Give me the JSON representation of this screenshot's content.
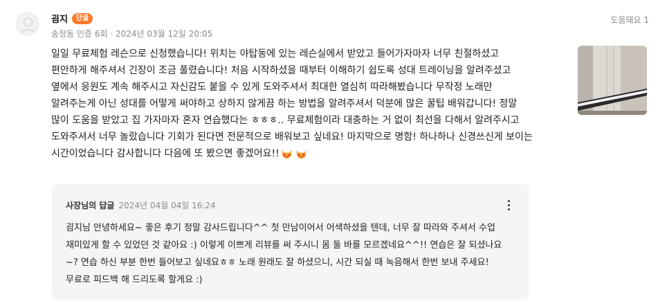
{
  "review": {
    "author": "굄지",
    "badge": "단골",
    "meta": "송정동 인증 6회 · 2024년 03월 12일 20:05",
    "helpful_label": "도움돼요 1",
    "body": "일일 무료체험 레슨으로 신청했습니다! 위치는 야탑동에 있는 레슨실에서 받았고 들어가자마자 너무 친절하셨고 편안하게 해주셔서 긴장이 조금 풀렸습니다! 처음 시작하셨을 때부터 이해하기 쉽도록 성대 트레이닝을 알려주셨고 옆에서 응원도 계속 해주시고 자신감도 붙을 수 있게 도와주셔서 최대한 열심히 따라해봤습니다 무작정 노래만 알려주는게 아닌 성대를 어떻게 써야하고 상하지 않게끔 하는 방법을 알려주셔서 덕분에 많은 꿀팁 배워갑니다! 정말 많이 도움을 받았고 집 가자마자 혼자 연습했다는 ㅎㅎㅎ.. 무료체험이라 대충하는 거 없이 최선을 다해서 알려주시고 도와주셔서 너무 놀랐습니다 기회가 된다면 전문적으로 배워보고 싶네요! 마지막으로 명함! 하나하나 신경쓰신게 보이는 시간이었습니다 감사합니다 다음에 또 봤으면 좋겠어요!!",
    "emojis": [
      "star-struck-cat-emoji",
      "star-struck-cat-emoji"
    ]
  },
  "reply": {
    "author": "사장님의 답글",
    "date": "2024년 04월 04일 16:24",
    "body": "굄지님 안녕하세요~ 좋은 후기 정말 감사드립니다^^ 첫 만남이어서 어색하셨을 텐데, 너무 잘 따라와 주셔서 수업 재미있게 할 수 있었던 것 같아요 :) 이렇게 이쁘게 리뷰를 써 주시니 몸 둘 바를 모르겠네요^^!! 연습은 잘 되셨나요~? 연습 하신 부분 한번 들어보고 싶네요ㅎㅎ 노래 원래도 잘 하셨으니, 시간 되실 때 녹음해서 한번 보내 주세요! 무료로 피드백 해 드리도록 할게요 :)"
  },
  "colors": {
    "badge": "#ff7a2b",
    "muted_text": "#8a8a8a",
    "reply_bg": "#f5f5f6"
  }
}
